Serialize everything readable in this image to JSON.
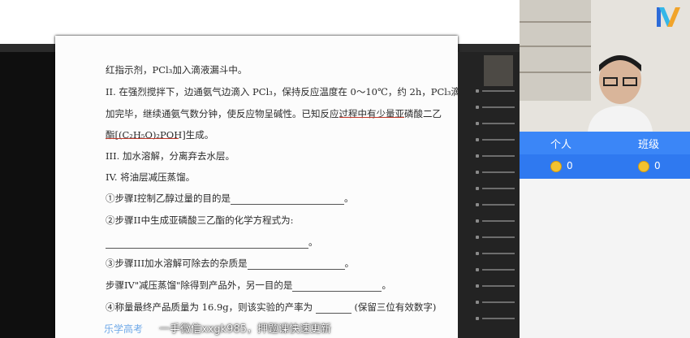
{
  "document": {
    "lines": [
      "红指示剂，PCl₃加入滴液漏斗中。",
      "II. 在强烈搅拌下，边通氨气边滴入 PCl₃，保持反应温度在 0～10℃，约 2h，PCl₃滴",
      "加完毕，继续通氨气数分钟，使反应物呈碱性。已知反应过程中有少量亚磷酸二乙",
      "酯[(C₂H₅O)₂POH]生成。",
      "III. 加水溶解，分离弃去水层。",
      "IV. 将油层减压蒸馏。",
      "①步骤I控制乙醇过量的目的是",
      "②步骤II中生成亚磷酸三乙酯的化学方程式为:",
      "③步骤III加水溶解可除去的杂质是",
      "步骤IV\"减压蒸馏\"除得到产品外，另一目的是",
      "④称量最终产品质量为 16.9g，则该实验的产率为",
      "(保留三位有效数字)"
    ],
    "punct": "。"
  },
  "panel": {
    "tab_personal": "个人",
    "tab_class": "班级",
    "score_personal": "0",
    "score_class": "0"
  },
  "watermark": {
    "brand": "乐学高考",
    "text": "一手微信xxgk985，押题课快速更新"
  },
  "colors": {
    "panel_blue": "#2f79f0",
    "coin": "#f2c230",
    "annotation_red": "#c0392b"
  }
}
